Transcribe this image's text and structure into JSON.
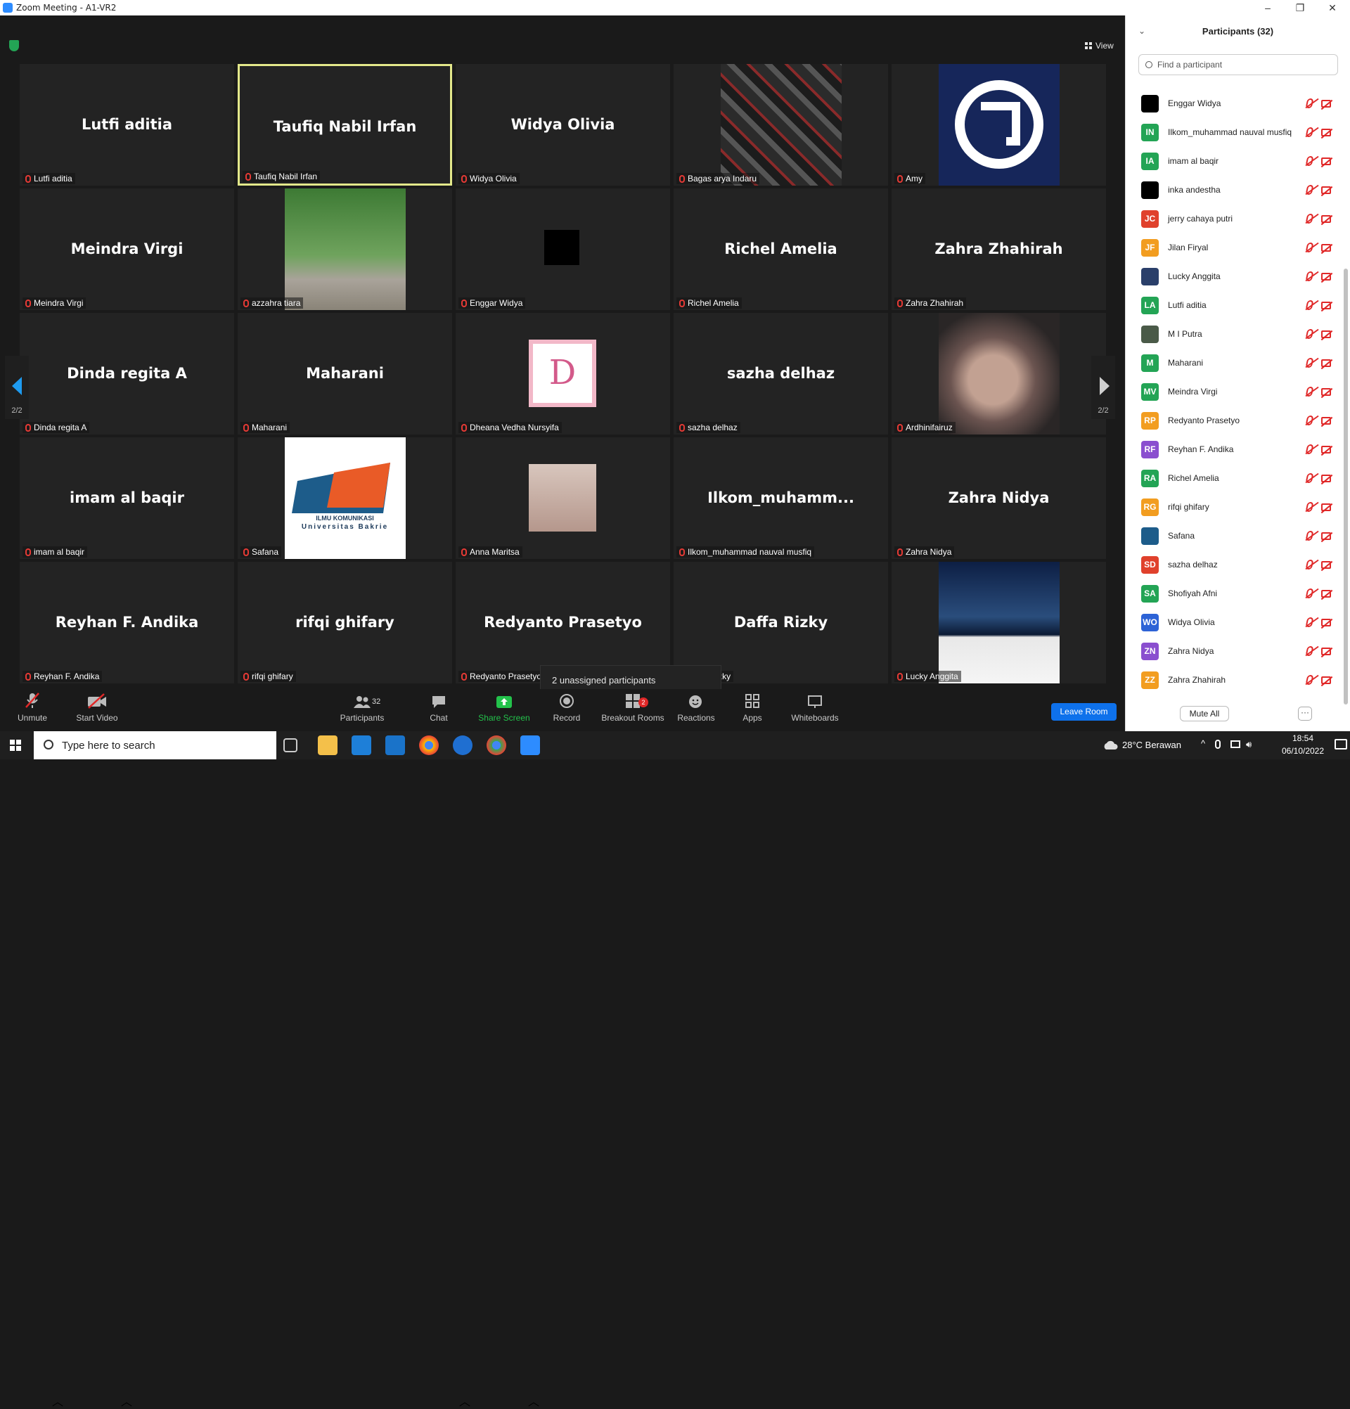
{
  "window": {
    "title": "Zoom Meeting - A1-VR2",
    "min": "–",
    "max": "❐",
    "close": "✕"
  },
  "top": {
    "view_label": "View"
  },
  "grid": [
    {
      "label": "Lutfi aditia",
      "big": "Lutfi aditia"
    },
    {
      "label": "Taufiq Nabil Irfan",
      "big": "Taufiq Nabil Irfan"
    },
    {
      "label": "Widya Olivia",
      "big": "Widya Olivia"
    },
    {
      "label": "Bagas arya Indaru",
      "big": ""
    },
    {
      "label": "Amy",
      "big": ""
    },
    {
      "label": "Meindra Virgi",
      "big": "Meindra Virgi"
    },
    {
      "label": "azzahra tiara",
      "big": ""
    },
    {
      "label": "Enggar Widya",
      "big": ""
    },
    {
      "label": "Richel Amelia",
      "big": "Richel Amelia"
    },
    {
      "label": "Zahra Zhahirah",
      "big": "Zahra Zhahirah"
    },
    {
      "label": "Dinda regita A",
      "big": "Dinda regita A"
    },
    {
      "label": "Maharani",
      "big": "Maharani"
    },
    {
      "label": "Dheana Vedha Nursyifa",
      "big": ""
    },
    {
      "label": "sazha delhaz",
      "big": "sazha delhaz"
    },
    {
      "label": "Ardhinifairuz",
      "big": ""
    },
    {
      "label": "imam al baqir",
      "big": "imam al baqir"
    },
    {
      "label": "Safana",
      "big": ""
    },
    {
      "label": "Anna Maritsa",
      "big": ""
    },
    {
      "label": "Ilkom_muhammad nauval musfiq",
      "big": "Ilkom_muhamm..."
    },
    {
      "label": "Zahra Nidya",
      "big": "Zahra Nidya"
    },
    {
      "label": "Reyhan F. Andika",
      "big": "Reyhan F. Andika"
    },
    {
      "label": "rifqi ghifary",
      "big": "rifqi ghifary"
    },
    {
      "label": "Redyanto Prasetyo",
      "big": "Redyanto Prasetyo"
    },
    {
      "label": "Daffa Rizky",
      "big": "Daffa Rizky"
    },
    {
      "label": "Lucky Anggita",
      "big": ""
    }
  ],
  "grid_extra": {
    "safana_logo_line1": "ILMU KOMUNIKASI",
    "safana_logo_line2": "Universitas Bakrie",
    "dheana_letter": "D",
    "bagas_tile_text": "",
    "amy_logo": ""
  },
  "nav": {
    "page_left": "2/2",
    "page_right": "2/2"
  },
  "unassigned": "2 unassigned participants",
  "toolbar": {
    "unmute": "Unmute",
    "start_video": "Start Video",
    "participants": "Participants",
    "participants_count": "32",
    "chat": "Chat",
    "share": "Share Screen",
    "record": "Record",
    "breakout": "Breakout Rooms",
    "breakout_badge": "2",
    "reactions": "Reactions",
    "apps": "Apps",
    "whiteboards": "Whiteboards",
    "leave": "Leave Room"
  },
  "panel": {
    "title": "Participants (32)",
    "search_placeholder": "Find a participant",
    "mute_all": "Mute All",
    "more": "···",
    "participants": [
      {
        "name": "Enggar Widya",
        "initials": "",
        "color": "#000000"
      },
      {
        "name": "Ilkom_muhammad nauval musfiq",
        "initials": "IN",
        "color": "#23a455"
      },
      {
        "name": "imam al baqir",
        "initials": "IA",
        "color": "#23a455"
      },
      {
        "name": "inka andestha",
        "initials": "",
        "color": "#000000"
      },
      {
        "name": "jerry cahaya putri",
        "initials": "JC",
        "color": "#e0412c"
      },
      {
        "name": "Jilan Firyal",
        "initials": "JF",
        "color": "#f29d20"
      },
      {
        "name": "Lucky Anggita",
        "initials": "",
        "color": "#2a3f6a"
      },
      {
        "name": "Lutfi aditia",
        "initials": "LA",
        "color": "#23a455"
      },
      {
        "name": "M I Putra",
        "initials": "",
        "color": "#4a5a48"
      },
      {
        "name": "Maharani",
        "initials": "M",
        "color": "#23a455"
      },
      {
        "name": "Meindra Virgi",
        "initials": "MV",
        "color": "#23a455"
      },
      {
        "name": "Redyanto Prasetyo",
        "initials": "RP",
        "color": "#f29d20"
      },
      {
        "name": "Reyhan F. Andika",
        "initials": "RF",
        "color": "#8a4fcf"
      },
      {
        "name": "Richel Amelia",
        "initials": "RA",
        "color": "#23a455"
      },
      {
        "name": "rifqi ghifary",
        "initials": "RG",
        "color": "#f29d20"
      },
      {
        "name": "Safana",
        "initials": "",
        "color": "#1d5c8a"
      },
      {
        "name": "sazha delhaz",
        "initials": "SD",
        "color": "#e0412c"
      },
      {
        "name": "Shofiyah Afni",
        "initials": "SA",
        "color": "#23a455"
      },
      {
        "name": "Widya Olivia",
        "initials": "WO",
        "color": "#2d63d6"
      },
      {
        "name": "Zahra Nidya",
        "initials": "ZN",
        "color": "#8a4fcf"
      },
      {
        "name": "Zahra Zhahirah",
        "initials": "ZZ",
        "color": "#f29d20"
      }
    ]
  },
  "taskbar": {
    "search": "Type here to search",
    "weather": "28°C Berawan",
    "time": "18:54",
    "date": "06/10/2022"
  }
}
